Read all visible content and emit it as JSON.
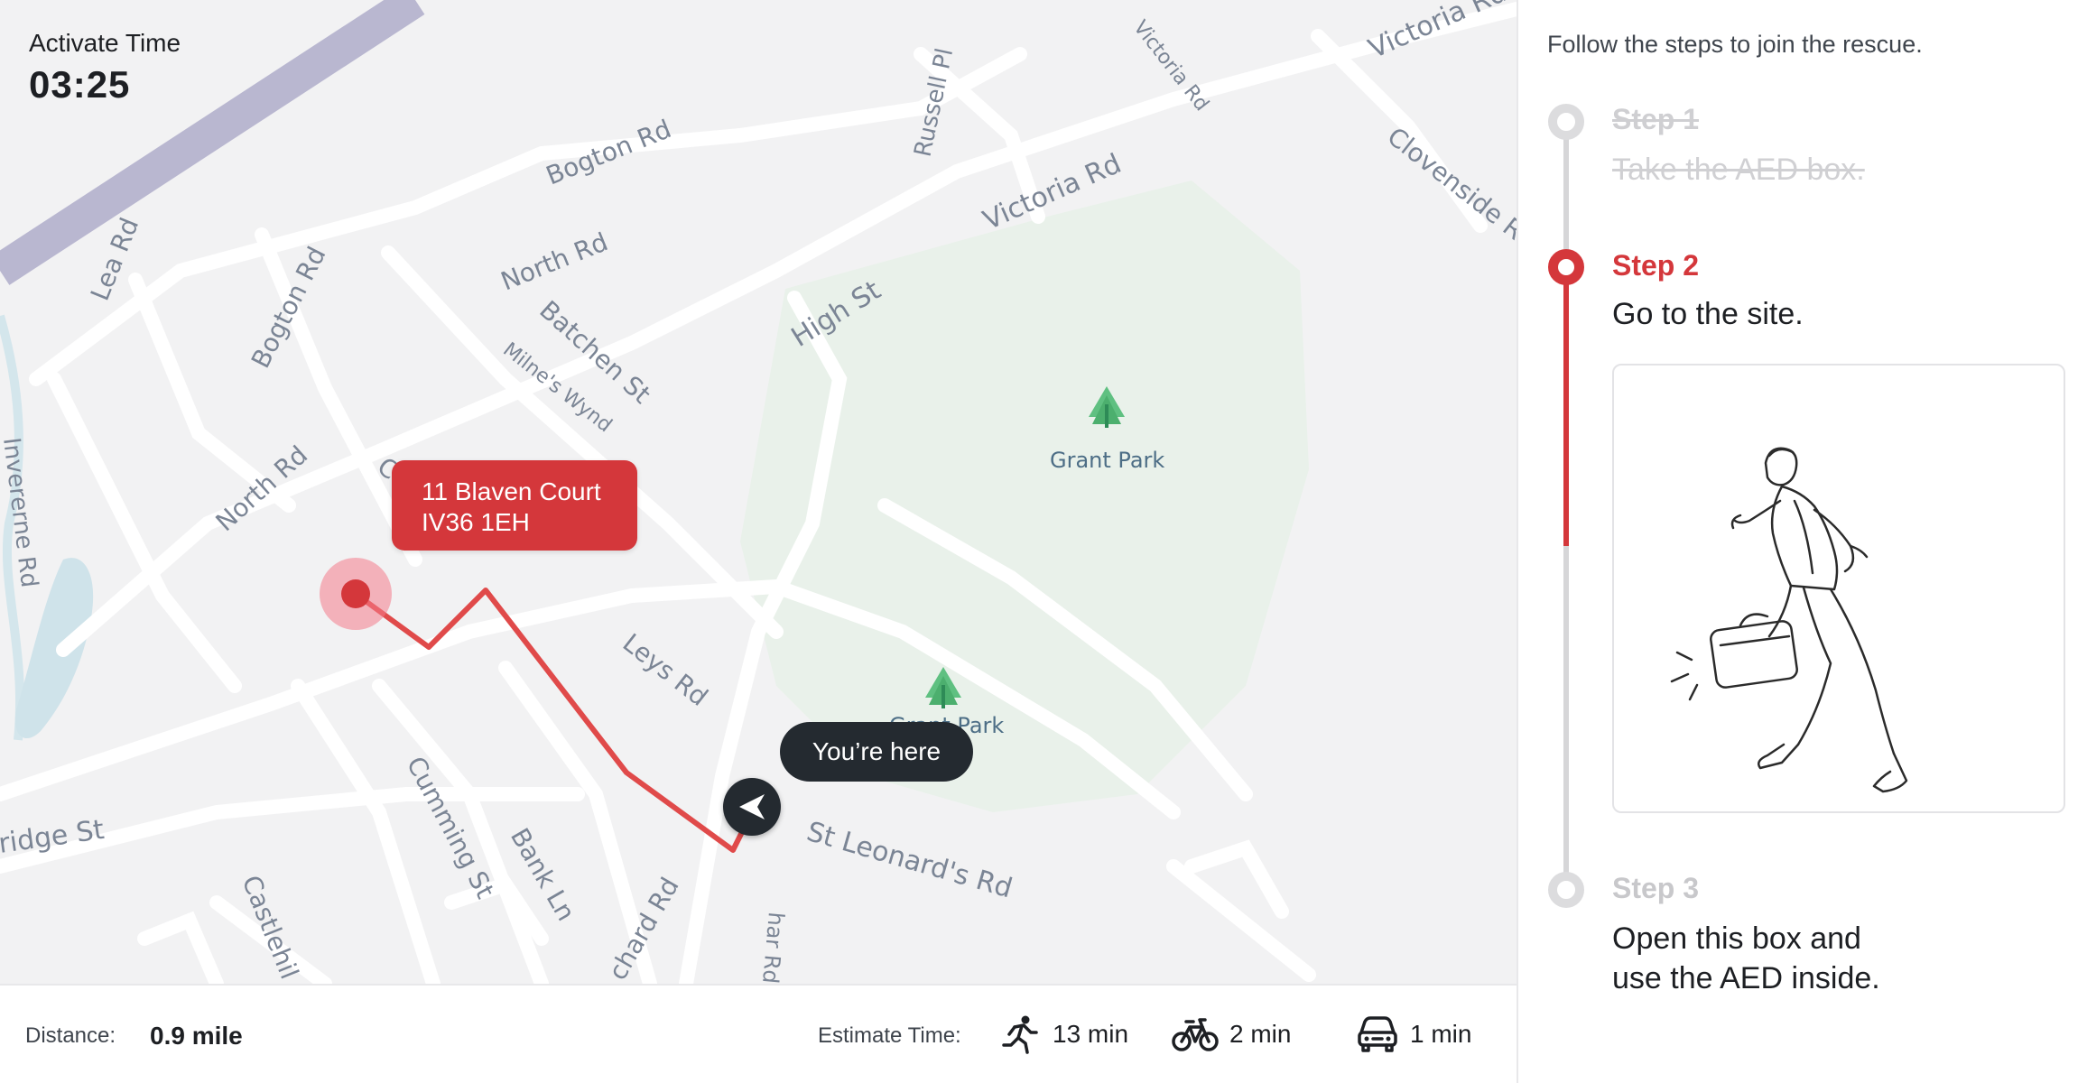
{
  "activate": {
    "label": "Activate Time",
    "value": "03:25"
  },
  "map": {
    "destination_address_line1": "11 Blaven Court",
    "destination_address_line2": "IV36 1EH",
    "you_are_here": "You’re here",
    "parks": [
      "Grant Park",
      "Grant Park"
    ],
    "roads": [
      "Bogton Rd",
      "Lea Rd",
      "Bogton Rd",
      "North Rd",
      "Batchen St",
      "Milne's Wynd",
      "High St",
      "Victoria Rd",
      "Russell Pl",
      "Victoria Rd",
      "Victoria Rd",
      "Clovenside R",
      "North Rd",
      "Co",
      "Leys Rd",
      "Invererne Rd",
      "ridge St",
      "Cumming St",
      "Bank Ln",
      "Castlehil",
      "chard Rd",
      "har Rd",
      "St Leonard's Rd"
    ],
    "colors": {
      "route": "#e04a4a",
      "pin": "#d4373b",
      "park": "#e8f1e9",
      "road": "#ffffff",
      "rail": "#b9b7d0",
      "water": "#cfe3ea"
    }
  },
  "bottom_bar": {
    "distance_label": "Distance:",
    "distance_value": "0.9 mile",
    "estimate_label": "Estimate Time:",
    "modes": [
      {
        "icon": "walking-icon",
        "value": "13 min"
      },
      {
        "icon": "bicycle-icon",
        "value": "2 min"
      },
      {
        "icon": "car-icon",
        "value": "1 min"
      }
    ]
  },
  "steps_panel": {
    "intro": "Follow the steps to join the rescue.",
    "steps": [
      {
        "title": "Step 1",
        "description": "Take the AED box.",
        "state": "done"
      },
      {
        "title": "Step 2",
        "description": "Go to the site.",
        "state": "active"
      },
      {
        "title": "Step 3",
        "description_line1": "Open this box and",
        "description_line2": "use the AED inside.",
        "state": "todo"
      }
    ],
    "illustration": "person-running-with-aed-box"
  }
}
